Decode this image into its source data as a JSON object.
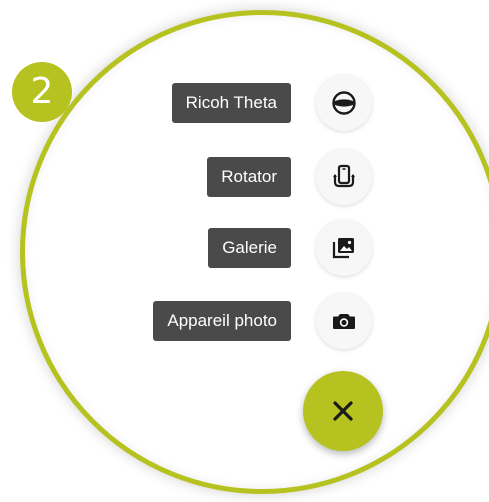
{
  "step": {
    "number": "2"
  },
  "menu": {
    "items": [
      {
        "label": "Ricoh Theta",
        "icon": "ricoh-theta-icon"
      },
      {
        "label": "Rotator",
        "icon": "rotator-icon"
      },
      {
        "label": "Galerie",
        "icon": "gallery-icon"
      },
      {
        "label": "Appareil photo",
        "icon": "camera-icon"
      }
    ],
    "close_icon": "close-icon"
  },
  "colors": {
    "accent": "#b6c21f",
    "label_bg": "#4a4a4a",
    "label_text": "#ffffff",
    "fab_bg": "#f7f7f7",
    "icon": "#1a1a1a"
  }
}
